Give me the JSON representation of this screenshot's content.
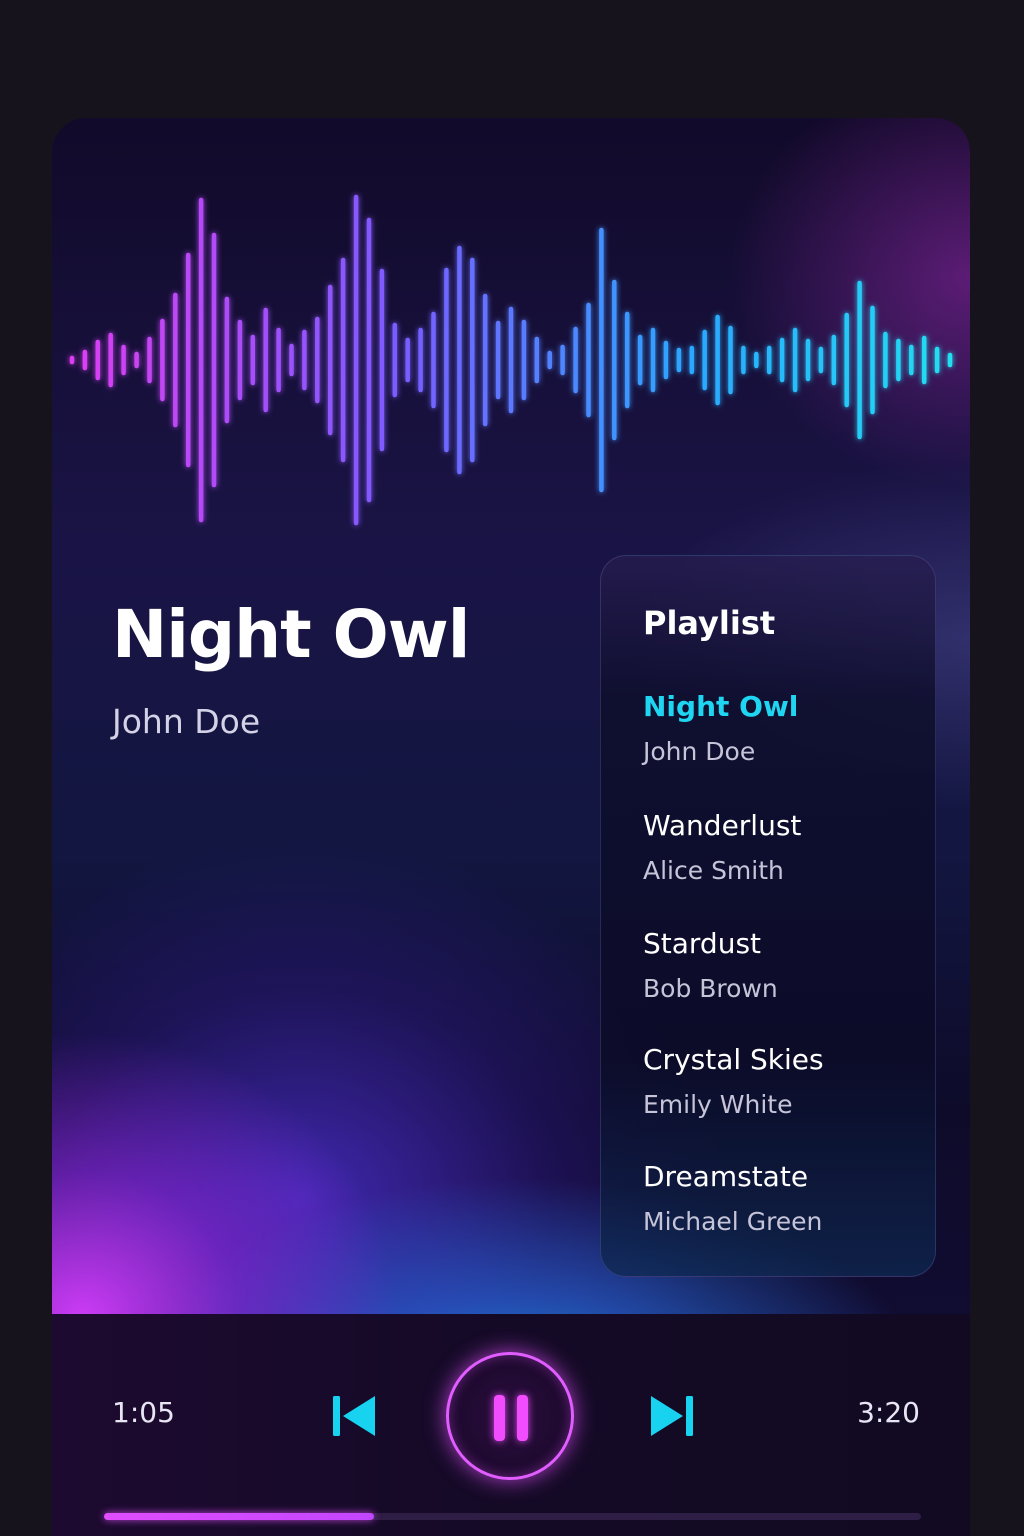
{
  "now_playing": {
    "title": "Night Owl",
    "artist": "John Doe"
  },
  "playlist": {
    "heading": "Playlist",
    "items": [
      {
        "title": "Night Owl",
        "artist": "John Doe",
        "active": true
      },
      {
        "title": "Wanderlust",
        "artist": "Alice Smith",
        "active": false
      },
      {
        "title": "Stardust",
        "artist": "Bob Brown",
        "active": false
      },
      {
        "title": "Crystal Skies",
        "artist": "Emily White",
        "active": false
      },
      {
        "title": "Dreamstate",
        "artist": "Michael Green",
        "active": false
      }
    ]
  },
  "player": {
    "current_time": "1:05",
    "total_time": "3:20",
    "progress": 0.33,
    "state": "playing",
    "icons": {
      "previous": "skip-previous-icon",
      "play_pause": "pause-icon",
      "next": "skip-next-icon"
    }
  },
  "colors": {
    "accent_cyan": "#1fd6f2",
    "accent_magenta": "#e25dff",
    "waveform_start": "#e23cf2",
    "waveform_mid": "#7a5cff",
    "waveform_end": "#22e3f0",
    "background": "#17131d"
  }
}
